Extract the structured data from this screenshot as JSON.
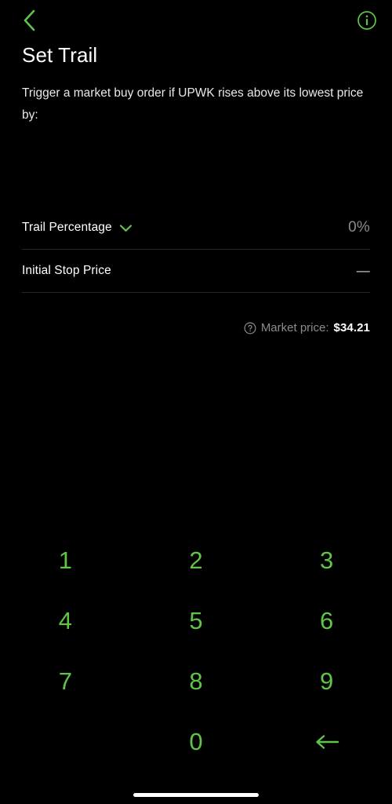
{
  "nav": {
    "back_icon": "chevron-left-icon",
    "info_icon": "info-circle-icon"
  },
  "header": {
    "title": "Set Trail",
    "description": "Trigger a market buy order if UPWK rises above its lowest price by:"
  },
  "form": {
    "rows": [
      {
        "label": "Trail Percentage",
        "value": "0%",
        "has_caret": true,
        "caret_icon": "chevron-down-icon"
      },
      {
        "label": "Initial Stop Price",
        "value": "—",
        "has_caret": false,
        "caret_icon": ""
      }
    ]
  },
  "market": {
    "help_icon": "question-circle-icon",
    "label": "Market price:",
    "price": "$34.21"
  },
  "keypad": {
    "keys": [
      {
        "label": "1",
        "name": "key-1",
        "type": "digit"
      },
      {
        "label": "2",
        "name": "key-2",
        "type": "digit"
      },
      {
        "label": "3",
        "name": "key-3",
        "type": "digit"
      },
      {
        "label": "4",
        "name": "key-4",
        "type": "digit"
      },
      {
        "label": "5",
        "name": "key-5",
        "type": "digit"
      },
      {
        "label": "6",
        "name": "key-6",
        "type": "digit"
      },
      {
        "label": "7",
        "name": "key-7",
        "type": "digit"
      },
      {
        "label": "8",
        "name": "key-8",
        "type": "digit"
      },
      {
        "label": "9",
        "name": "key-9",
        "type": "digit"
      },
      {
        "label": "",
        "name": "key-blank",
        "type": "empty"
      },
      {
        "label": "0",
        "name": "key-0",
        "type": "digit"
      },
      {
        "label": "←",
        "name": "key-backspace",
        "type": "backspace"
      }
    ]
  },
  "colors": {
    "background": "#000000",
    "accent_green": "#5fc447",
    "text_primary": "#ffffff",
    "text_muted": "#8c8c8c",
    "divider": "#262626"
  }
}
